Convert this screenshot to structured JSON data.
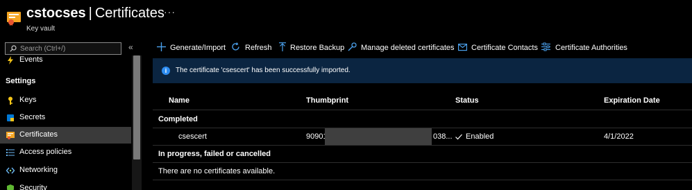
{
  "header": {
    "resource_name": "cstocses",
    "separator": "|",
    "blade_title": "Certificates",
    "more_label": "···",
    "resource_type": "Key vault"
  },
  "sidebar": {
    "search_placeholder": "Search (Ctrl+/)",
    "collapse_label": "«",
    "items": [
      {
        "label": "Events",
        "icon": "lightning-icon"
      },
      {
        "label": "Keys",
        "icon": "key-icon"
      },
      {
        "label": "Secrets",
        "icon": "secret-icon"
      },
      {
        "label": "Certificates",
        "icon": "certificate-icon",
        "selected": true
      },
      {
        "label": "Access policies",
        "icon": "access-policies-icon"
      },
      {
        "label": "Networking",
        "icon": "networking-icon"
      },
      {
        "label": "Security",
        "icon": "shield-icon"
      }
    ],
    "section_settings": "Settings"
  },
  "toolbar": {
    "generate_import": "Generate/Import",
    "refresh": "Refresh",
    "restore_backup": "Restore Backup",
    "manage_deleted": "Manage deleted certificates",
    "certificate_contacts": "Certificate Contacts",
    "certificate_authorities": "Certificate Authorities"
  },
  "banner": {
    "message": "The certificate 'csescert' has been successfully imported.",
    "background": "#0b2541"
  },
  "table": {
    "columns": [
      "Name",
      "Thumbprint",
      "Status",
      "Expiration Date"
    ],
    "group_completed": "Completed",
    "rows": [
      {
        "name": "csescert",
        "thumbprint_start": "90901",
        "thumbprint_end": "038...",
        "status": "Enabled",
        "expiration": "4/1/2022"
      }
    ],
    "group_in_progress": "In progress, failed or cancelled",
    "empty_message": "There are no certificates available."
  },
  "colors": {
    "accent": "#0078d4",
    "selected_nav": "#3a3a3a"
  }
}
